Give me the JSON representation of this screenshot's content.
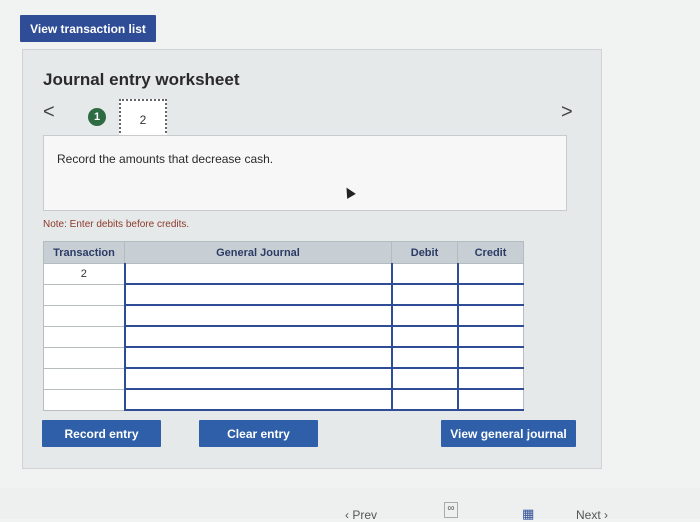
{
  "top_button": {
    "label": "View transaction list"
  },
  "worksheet": {
    "title": "Journal entry worksheet",
    "nav_prev": "<",
    "nav_next": ">",
    "steps": [
      {
        "number": "1",
        "state": "completed"
      },
      {
        "number": "2",
        "state": "current"
      }
    ],
    "instruction": "Record the amounts that decrease cash.",
    "note": "Note: Enter debits before credits."
  },
  "table": {
    "headers": [
      "Transaction",
      "General Journal",
      "Debit",
      "Credit"
    ],
    "rows": [
      [
        "2",
        "",
        "",
        ""
      ],
      [
        "",
        "",
        "",
        ""
      ],
      [
        "",
        "",
        "",
        ""
      ],
      [
        "",
        "",
        "",
        ""
      ],
      [
        "",
        "",
        "",
        ""
      ],
      [
        "",
        "",
        "",
        ""
      ],
      [
        "",
        "",
        "",
        ""
      ]
    ]
  },
  "buttons": {
    "record": "Record entry",
    "clear": "Clear entry",
    "view_journal": "View general journal"
  },
  "footer": {
    "prev": "Prev",
    "next": "Next"
  },
  "colors": {
    "accent": "#2f4c96",
    "button": "#2f5fa8",
    "step_done": "#2e6b43",
    "note": "#8b3a2a"
  }
}
